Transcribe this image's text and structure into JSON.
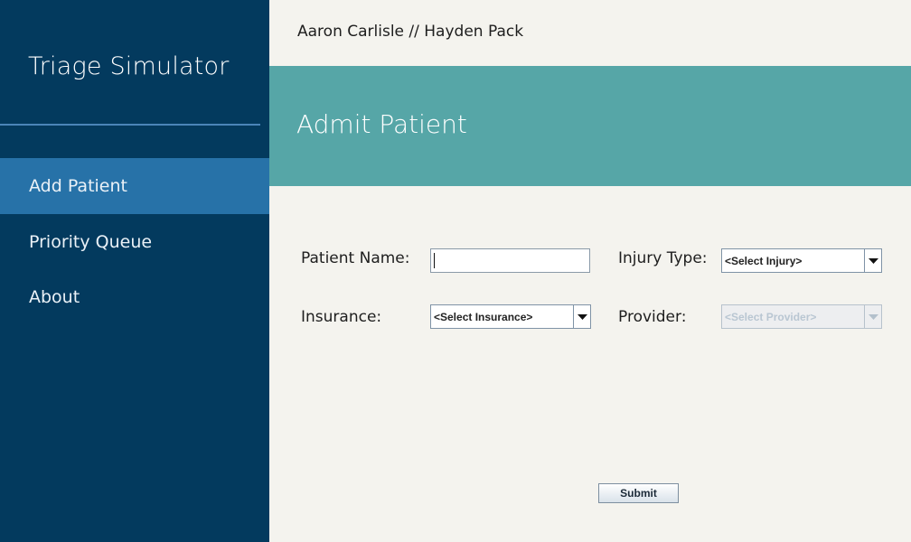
{
  "sidebar": {
    "app_title": "Triage Simulator",
    "nav": [
      {
        "label": "Add Patient",
        "active": true
      },
      {
        "label": "Priority Queue",
        "active": false
      },
      {
        "label": "About",
        "active": false
      }
    ]
  },
  "header": {
    "authors": "Aaron Carlisle // Hayden Pack"
  },
  "banner": {
    "title": "Admit Patient"
  },
  "form": {
    "patient_name_label": "Patient Name:",
    "patient_name_value": "",
    "injury_type_label": "Injury Type:",
    "injury_type_selected": "<Select Injury>",
    "insurance_label": "Insurance:",
    "insurance_selected": "<Select Insurance>",
    "provider_label": "Provider:",
    "provider_selected": "<Select Provider>",
    "provider_disabled": true,
    "submit_label": "Submit"
  },
  "icons": {
    "dropdown": "chevron-down-icon"
  },
  "colors": {
    "sidebar_bg": "#033a5e",
    "sidebar_active": "#2772a8",
    "banner_bg": "#56a6a7",
    "content_bg": "#f4f3ee"
  }
}
